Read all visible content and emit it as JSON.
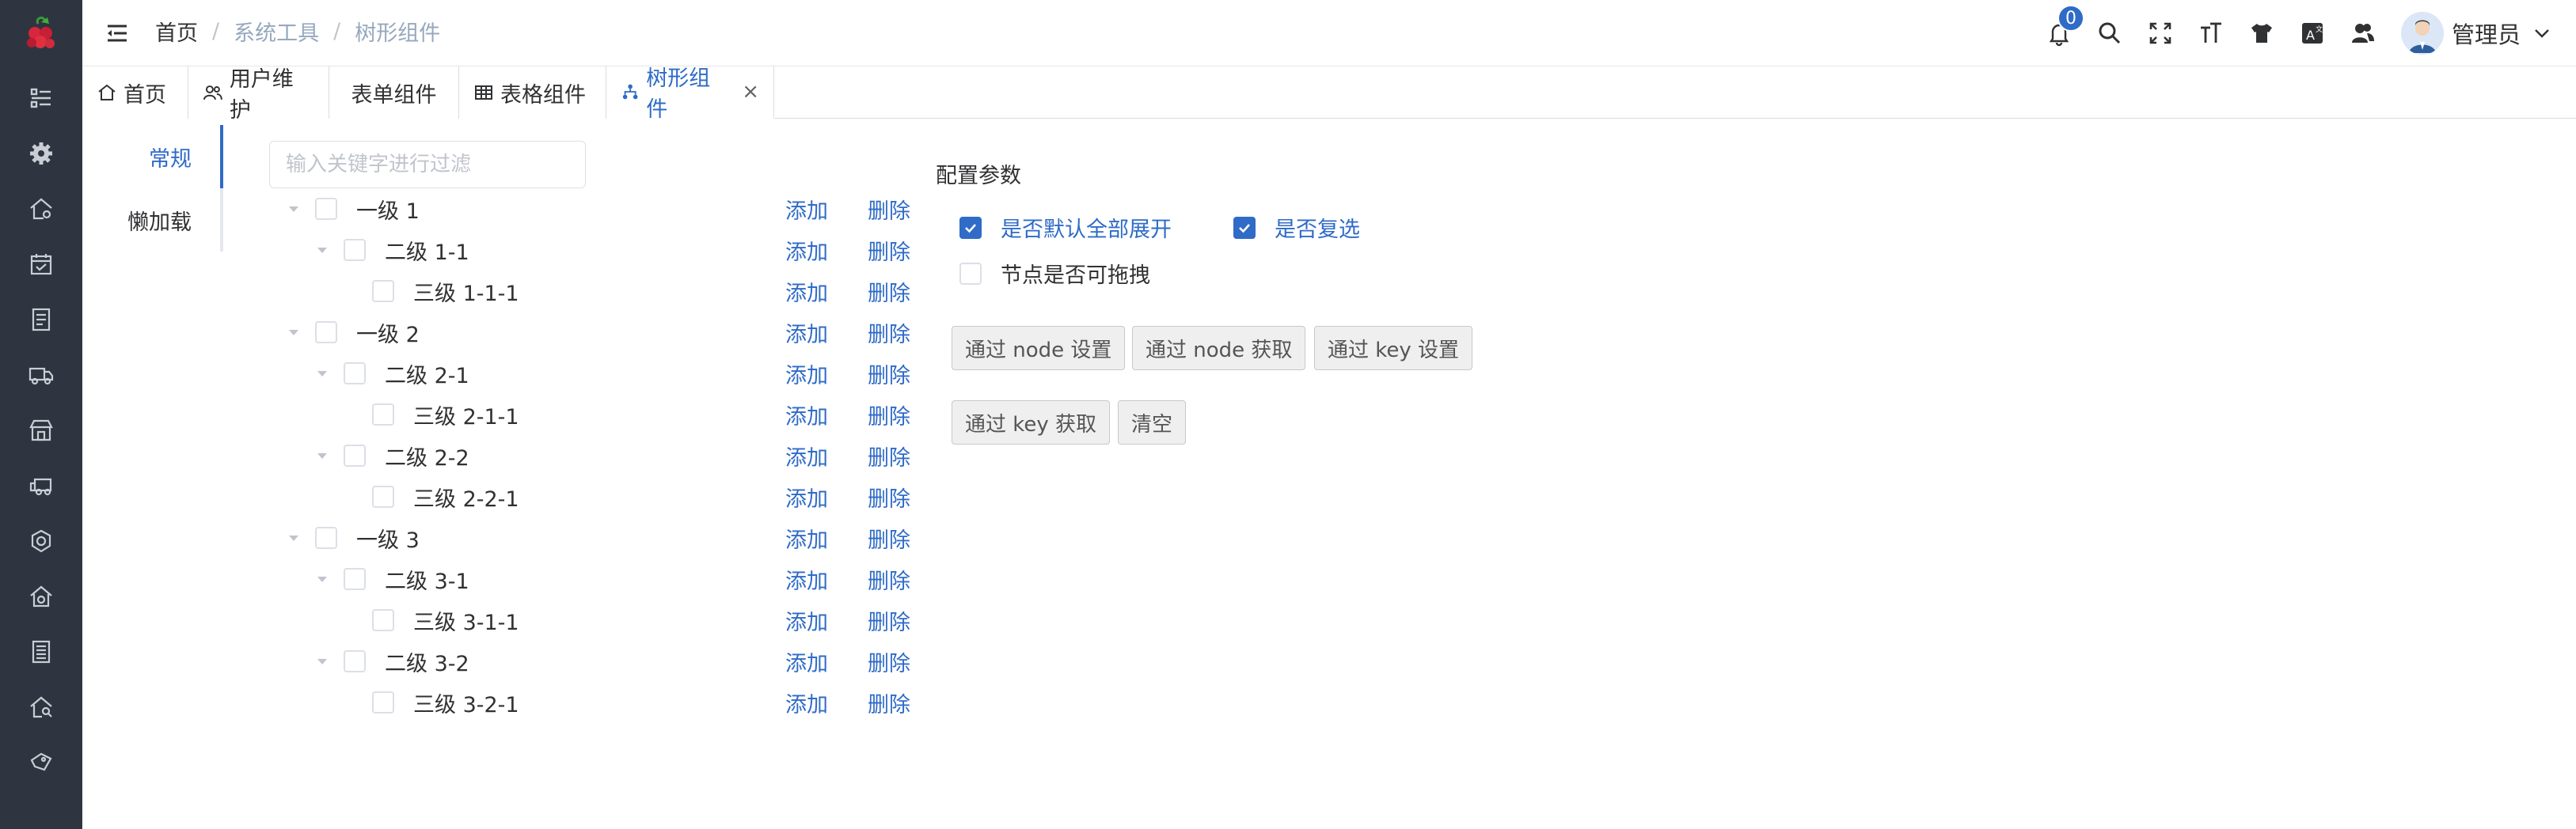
{
  "sidebar": {
    "logo": "logo-icon",
    "items": [
      {
        "icon": "list-icon"
      },
      {
        "icon": "gear-icon"
      },
      {
        "icon": "home-gear-icon"
      },
      {
        "icon": "calendar-check-icon"
      },
      {
        "icon": "document-icon"
      },
      {
        "icon": "truck-icon"
      },
      {
        "icon": "store-icon"
      },
      {
        "icon": "delivery-truck-icon"
      },
      {
        "icon": "settings-cog-icon"
      },
      {
        "icon": "house-settings-icon"
      },
      {
        "icon": "list-document-icon"
      },
      {
        "icon": "house-search-icon"
      },
      {
        "icon": "tag-hand-icon"
      }
    ]
  },
  "header": {
    "breadcrumb": {
      "home": "首页",
      "sep": "/",
      "level1": "系统工具",
      "level2": "树形组件"
    },
    "notifications": {
      "count": "0"
    },
    "user": {
      "name": "管理员"
    }
  },
  "tabs": [
    {
      "label": "首页",
      "icon": "home-icon"
    },
    {
      "label": "用户维护",
      "icon": "users-icon"
    },
    {
      "label": "表单组件",
      "icon": ""
    },
    {
      "label": "表格组件",
      "icon": "table-icon"
    },
    {
      "label": "树形组件",
      "icon": "tree-icon",
      "active": true,
      "close": "×"
    }
  ],
  "vtabs": [
    {
      "label": "常规",
      "active": true
    },
    {
      "label": "懒加载"
    }
  ],
  "filter": {
    "placeholder": "输入关键字进行过滤",
    "value": ""
  },
  "tree": {
    "add_label": "添加",
    "delete_label": "删除",
    "nodes": [
      {
        "label": "一级 1",
        "level": 1,
        "expandable": true
      },
      {
        "label": "二级 1-1",
        "level": 2,
        "expandable": true
      },
      {
        "label": "三级 1-1-1",
        "level": 3,
        "expandable": false
      },
      {
        "label": "一级 2",
        "level": 1,
        "expandable": true
      },
      {
        "label": "二级 2-1",
        "level": 2,
        "expandable": true
      },
      {
        "label": "三级 2-1-1",
        "level": 3,
        "expandable": false
      },
      {
        "label": "二级 2-2",
        "level": 2,
        "expandable": true
      },
      {
        "label": "三级 2-2-1",
        "level": 3,
        "expandable": false
      },
      {
        "label": "一级 3",
        "level": 1,
        "expandable": true
      },
      {
        "label": "二级 3-1",
        "level": 2,
        "expandable": true
      },
      {
        "label": "三级 3-1-1",
        "level": 3,
        "expandable": false
      },
      {
        "label": "二级 3-2",
        "level": 2,
        "expandable": true
      },
      {
        "label": "三级 3-2-1",
        "level": 3,
        "expandable": false
      }
    ]
  },
  "config": {
    "title": "配置参数",
    "options": [
      {
        "label": "是否默认全部展开",
        "checked": true
      },
      {
        "label": "是否复选",
        "checked": true
      },
      {
        "label": "节点是否可拖拽",
        "checked": false
      }
    ],
    "buttons": [
      "通过 node 设置",
      "通过 node 获取",
      "通过 key 设置",
      "通过 key 获取",
      "清空"
    ]
  },
  "colors": {
    "accent": "#2f6bc7",
    "sidebar": "#2f3540"
  }
}
